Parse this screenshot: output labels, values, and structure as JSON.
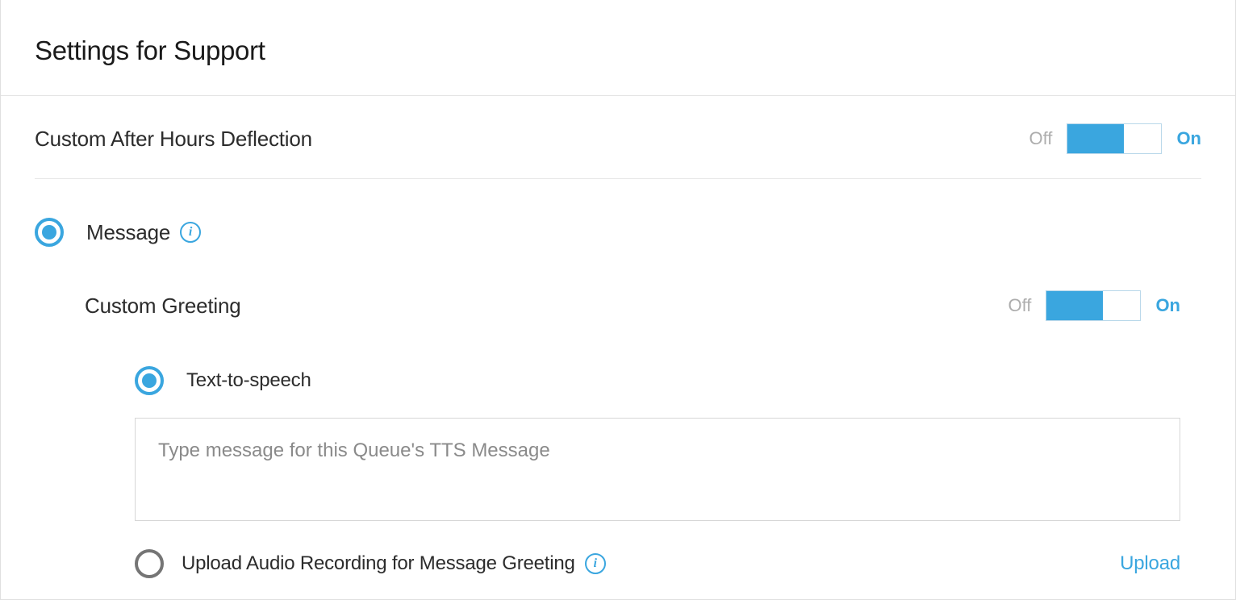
{
  "header": {
    "title": "Settings for Support"
  },
  "deflection": {
    "label": "Custom After Hours Deflection",
    "toggle": {
      "off_label": "Off",
      "on_label": "On"
    }
  },
  "message": {
    "radio_label": "Message"
  },
  "greeting": {
    "label": "Custom Greeting",
    "toggle": {
      "off_label": "Off",
      "on_label": "On"
    },
    "tts": {
      "radio_label": "Text-to-speech",
      "placeholder": "Type message for this Queue's TTS Message"
    },
    "upload": {
      "radio_label": "Upload Audio Recording for Message Greeting",
      "link_label": "Upload"
    }
  }
}
